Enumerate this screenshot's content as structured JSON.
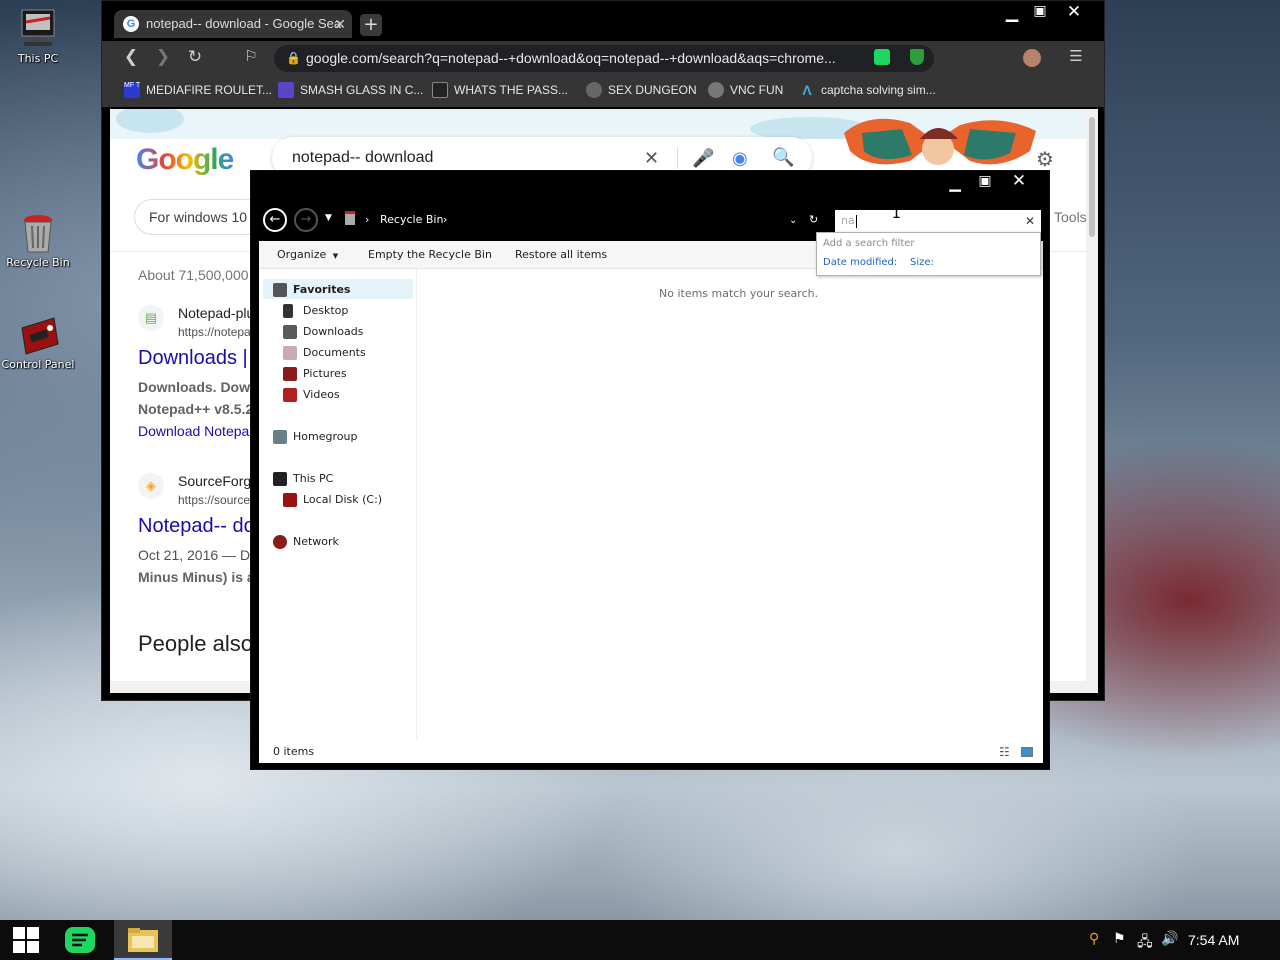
{
  "desktop": {
    "icons": [
      {
        "label": "This PC",
        "icon": "this-pc-icon"
      },
      {
        "label": "Recycle Bin",
        "icon": "recycle-bin-icon"
      },
      {
        "label": "Control Panel",
        "icon": "control-panel-icon"
      }
    ]
  },
  "chrome": {
    "tab_title": "notepad-- download - Google Sea",
    "url": "google.com/search?q=notepad--+download&oq=notepad--+download&aqs=chrome...",
    "bookmarks": [
      {
        "label": "MEDIAFIRE ROULET...",
        "icon_text": "MF T",
        "color": "#2b3bd1"
      },
      {
        "label": "SMASH GLASS IN C...",
        "icon_text": "",
        "color": "#5a45c9"
      },
      {
        "label": "WHATS THE PASS...",
        "icon_text": "",
        "color": "#222222"
      },
      {
        "label": "SEX DUNGEON",
        "icon_text": "",
        "color": "#666666"
      },
      {
        "label": "VNC FUN",
        "icon_text": "",
        "color": "#777777"
      },
      {
        "label": "captcha solving sim...",
        "icon_text": "Λ",
        "color": "#4fa3e0"
      }
    ]
  },
  "google": {
    "logo": "Google",
    "query": "notepad-- download",
    "chip": "For windows 10",
    "tools": "Tools",
    "stats": "About 71,500,000",
    "result1": {
      "site": "Notepad-plu",
      "url": "https://notepa",
      "title": "Downloads |",
      "text1": "Downloads. Dow",
      "text2": "Notepad++ v8.5.2",
      "link": "Download Notepa"
    },
    "result2": {
      "site": "SourceForg",
      "url": "https://source",
      "title": "Notepad-- do",
      "text1": "Oct 21, 2016 — D",
      "text2": "Minus Minus) is a"
    },
    "people_also": "People also"
  },
  "explorer": {
    "breadcrumb": "Recycle Bin",
    "search_value": "na",
    "commands": {
      "organize": "Organize",
      "empty": "Empty the Recycle Bin",
      "restore": "Restore all items"
    },
    "suggest": {
      "hint": "Add a search filter",
      "date": "Date modified:",
      "size": "Size:"
    },
    "nav": {
      "favorites": "Favorites",
      "desktop": "Desktop",
      "downloads": "Downloads",
      "documents": "Documents",
      "pictures": "Pictures",
      "videos": "Videos",
      "homegroup": "Homegroup",
      "this_pc": "This PC",
      "local_disk": "Local Disk (C:)",
      "network": "Network"
    },
    "empty_message": "No items match your search.",
    "status": "0 items"
  },
  "taskbar": {
    "time": "7:54 AM"
  },
  "colors": {
    "accent": "#1a0dab",
    "spotify": "#1ed760"
  }
}
